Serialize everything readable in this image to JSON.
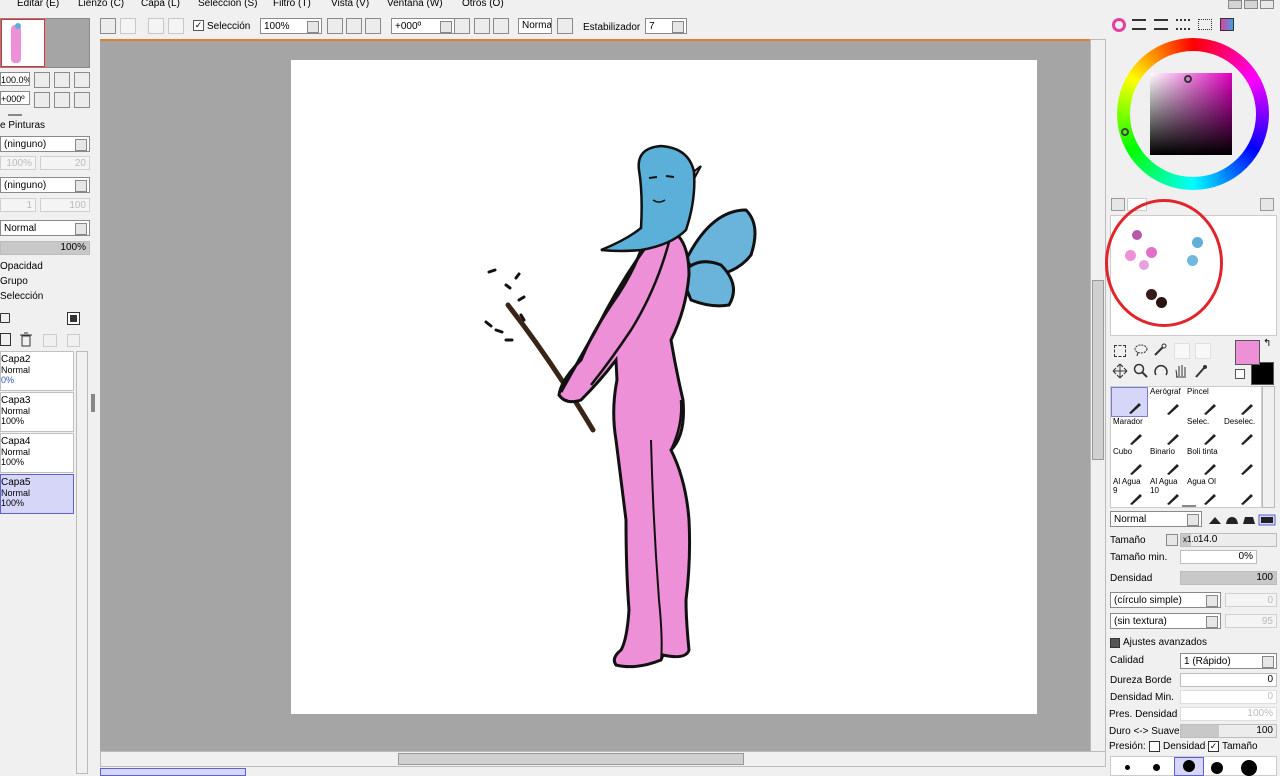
{
  "menu": [
    "Editar (E)",
    "Lienzo (C)",
    "Capa (L)",
    "Selección (S)",
    "Filtro (T)",
    "Vista (V)",
    "Ventana (W)",
    "Otros (O)"
  ],
  "toolbar": {
    "selection_label": "Selección",
    "zoom": "100%",
    "rotation": "+000º",
    "mode": "Normal",
    "stabilizer_label": "Estabilizador",
    "stabilizer_value": "7"
  },
  "navigator": {
    "zoom": "100.0%",
    "rotation": "+000º"
  },
  "paper": {
    "title": "e Pinturas",
    "texture": "(ninguno)",
    "texture_pct": "100%",
    "texture_val": "20",
    "effect": "(ninguno)",
    "effect_val1": "1",
    "effect_val2": "100"
  },
  "layer_props": {
    "blend": "Normal",
    "opacity_value": "100%",
    "opacity_fraction": 1.0,
    "opt1": "Opacidad",
    "opt2": "Grupo",
    "opt3": "Selección"
  },
  "layers": [
    {
      "name": "Capa2",
      "mode": "Normal",
      "opacity": "0%"
    },
    {
      "name": "Capa3",
      "mode": "Normal",
      "opacity": "100%"
    },
    {
      "name": "Capa4",
      "mode": "Normal",
      "opacity": "100%"
    },
    {
      "name": "Capa5",
      "mode": "Normal",
      "opacity": "100%",
      "selected": true
    }
  ],
  "colors": {
    "primary": "#ee90d8",
    "secondary": "#000000",
    "palette": [
      "#b45aa8",
      "#e070c8",
      "#c060b0",
      "#ee90d8",
      "#e8a0dc",
      "#60b0d8",
      "#70b8e0",
      "#3a1a18",
      "#2a1412"
    ],
    "canvas_bg": "#a5a5a5",
    "annotation": "#e0262c"
  },
  "tools": [
    {
      "label": "",
      "selected": true
    },
    {
      "label": "Aerógraf",
      "selected": false
    },
    {
      "label": "Pincel",
      "selected": false
    },
    {
      "label": "",
      "selected": false
    },
    {
      "label": "Marador",
      "selected": false
    },
    {
      "label": "",
      "selected": false
    },
    {
      "label": "Selec.",
      "selected": false
    },
    {
      "label": "Deselec.",
      "selected": false
    },
    {
      "label": "Cubo",
      "selected": false
    },
    {
      "label": "Binario",
      "selected": false
    },
    {
      "label": "Boli tinta",
      "selected": false
    },
    {
      "label": "",
      "selected": false
    },
    {
      "label": "Al Agua 9",
      "selected": false
    },
    {
      "label": "Al Agua 10",
      "selected": false
    },
    {
      "label": "Agua Ol",
      "selected": false
    },
    {
      "label": "",
      "selected": false
    }
  ],
  "brush": {
    "blend": "Normal",
    "size_label": "Tamaño",
    "size_mult": "x1.0",
    "size_value": "14.0",
    "min_size_label": "Tamaño min.",
    "min_size_value": "0%",
    "density_label": "Densidad",
    "density_value": "100",
    "shape": "(círculo simple)",
    "shape_val": "0",
    "texture": "(sin textura)",
    "texture_val": "95",
    "advanced_label": "Ajustes avanzados",
    "quality_label": "Calidad",
    "quality_value": "1 (Rápido)",
    "edge_label": "Dureza Borde",
    "edge_value": "0",
    "min_density_label": "Densidad Min.",
    "min_density_value": "0",
    "pressure_density_label": "Pres. Densidad M",
    "pressure_density_value": "100%",
    "hard_soft_label": "Duro <-> Suave",
    "hard_soft_value": "100",
    "pressure_label": "Presión:",
    "pressure_density_cb": "Densidad",
    "pressure_size_cb": "Tamaño"
  }
}
